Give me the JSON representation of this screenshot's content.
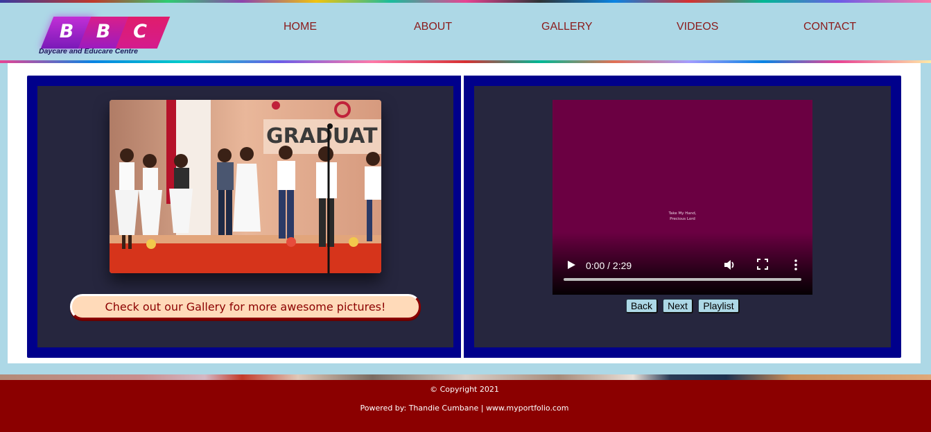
{
  "logo": {
    "letters": [
      "B",
      "B",
      "C"
    ],
    "tagline": "Daycare and Educare Centre"
  },
  "nav": {
    "home": "HOME",
    "about": "ABOUT",
    "gallery": "GALLERY",
    "videos": "VIDEOS",
    "contact": "CONTACT"
  },
  "gallery_card": {
    "photo_icon": "graduation-photo",
    "banner": "Check out our Gallery for more awesome pictures!"
  },
  "video_card": {
    "caption": "Take My Hand,\nPrecious Lord",
    "time": "0:00 / 2:29",
    "progress": 0,
    "buttons": {
      "back": "Back",
      "next": "Next",
      "playlist": "Playlist"
    },
    "icons": [
      "play-icon",
      "volume-icon",
      "fullscreen-icon",
      "more-options-icon"
    ]
  },
  "footer": {
    "copyright": "© Copyright 2021",
    "powered_by": "Powered by: Thandie Cumbane | www.myportfolio.com"
  },
  "colors": {
    "header_bg": "#add8e6",
    "nav_text": "#8b1a1a",
    "panel_border": "#00008b",
    "card_bg": "#26263e",
    "video_bg": "#6b0042",
    "banner_bg": "#ffdab9",
    "footer_bg": "#8b0000"
  }
}
